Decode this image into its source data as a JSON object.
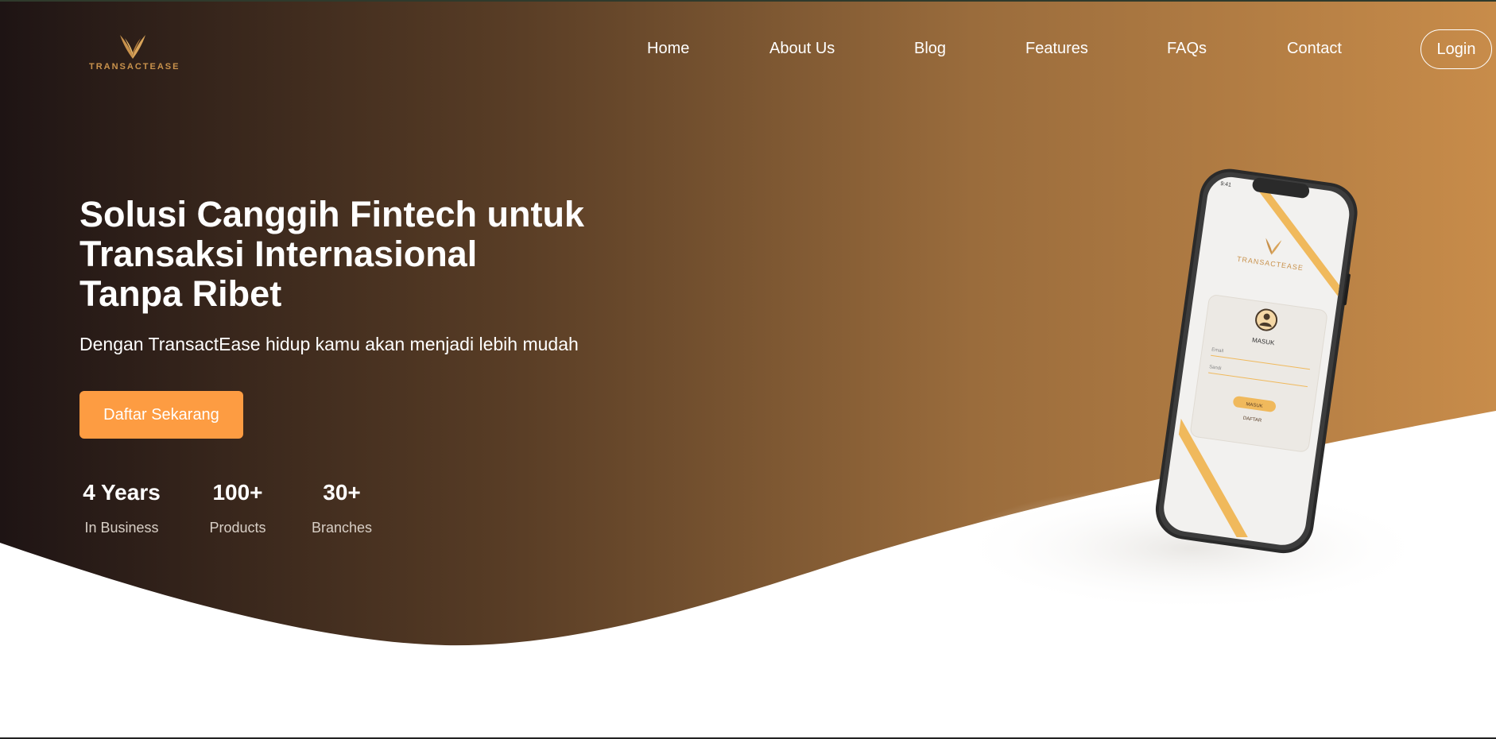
{
  "brand": {
    "name": "TRANSACTEASE"
  },
  "nav": {
    "items": [
      {
        "label": "Home"
      },
      {
        "label": "About Us"
      },
      {
        "label": "Blog"
      },
      {
        "label": "Features"
      },
      {
        "label": "FAQs"
      },
      {
        "label": "Contact"
      }
    ],
    "login_label": "Login"
  },
  "hero": {
    "headline_lines": [
      "Solusi Canggih Fintech untuk",
      "Transaksi Internasional",
      "Tanpa Ribet"
    ],
    "subheadline": "Dengan TransactEase hidup kamu akan menjadi lebih mudah",
    "cta_label": "Daftar Sekarang",
    "stats": [
      {
        "value": "4 Years",
        "label": "In Business"
      },
      {
        "value": "100+",
        "label": "Products"
      },
      {
        "value": "30+",
        "label": "Branches"
      }
    ]
  },
  "phone": {
    "status_time": "9:41",
    "brand": "TRANSACTEASE",
    "login_title": "MASUK",
    "email_placeholder": "Email",
    "password_placeholder": "Sandi",
    "submit_label": "MASUK",
    "register_label": "DAFTAR"
  },
  "colors": {
    "gradient_start": "#1e1414",
    "gradient_end": "#c88c4a",
    "cta": "#fd9c42",
    "accent_gold": "#c9924c"
  },
  "icons": {
    "logo": "wing-logo-icon",
    "avatar": "user-avatar-icon"
  }
}
